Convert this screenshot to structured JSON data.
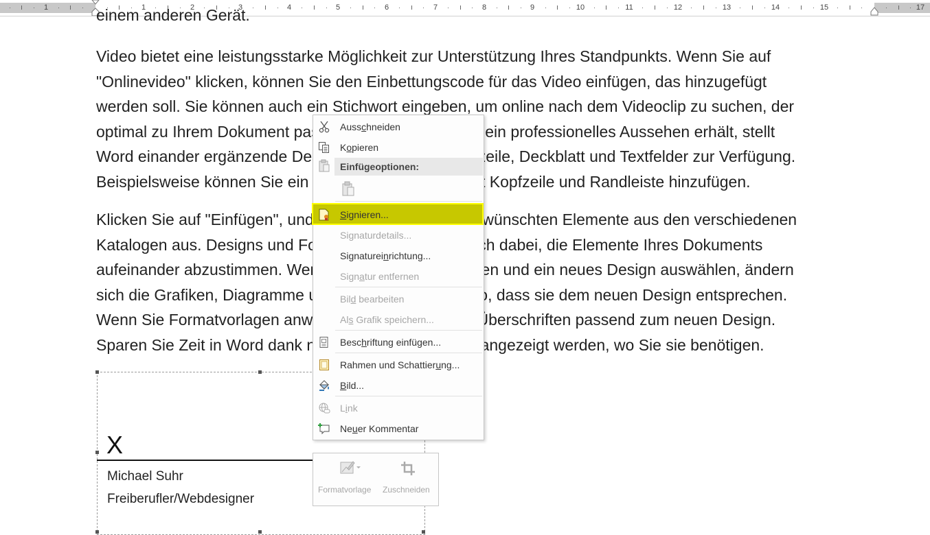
{
  "ruler": {
    "numbers_left": [
      "1"
    ],
    "numbers_right": [
      "1",
      "2",
      "3",
      "4",
      "5",
      "6",
      "7",
      "8",
      "9",
      "10",
      "11",
      "12",
      "13",
      "14",
      "15",
      "17"
    ]
  },
  "document": {
    "line_top": "einem anderen Gerät.",
    "para1": [
      "Video bietet eine leistungsstarke Möglichkeit zur Unterstützung Ihres Standpunkts. Wenn Sie auf",
      "\"Onlinevideo\" klicken, können Sie den Einbettungscode für das Video einfügen, das hinzugefügt",
      "werden soll. Sie können auch ein Stichwort eingeben, um online nach dem Videoclip zu suchen, der",
      "optimal zu Ihrem Dokument passt. Damit Ihr Dokument ein professionelles Aussehen erhält, stellt",
      "Word einander ergänzende Designs für Kopfzeile, Fußzeile, Deckblatt und Textfelder zur Verfügung.",
      "Beispielsweise können Sie ein passendes Deckblatt mit Kopfzeile und Randleiste hinzufügen."
    ],
    "para2": [
      "Klicken Sie auf \"Einfügen\", und wählen Sie dann die gewünschten Elemente aus den verschiedenen",
      "Katalogen aus. Designs und Formatvorlagen helfen auch dabei, die Elemente Ihres Dokuments",
      "aufeinander abzustimmen. Wenn Sie auf \"Design\" klicken und ein neues Design auswählen, ändern",
      "sich die Grafiken, Diagramme und SmartArt-Grafiken so, dass sie dem neuen Design entsprechen.",
      "Wenn Sie Formatvorlagen anwenden, ändern sich die Überschriften passend zum neuen Design.",
      "Sparen Sie Zeit in Word dank neuer Schaltflächen, die angezeigt werden, wo Sie sie benötigen."
    ]
  },
  "signature": {
    "x": "X",
    "name": "Michael Suhr",
    "title": "Freiberufler/Webdesigner"
  },
  "context_menu": {
    "cut": {
      "pre": "Auss",
      "u": "c",
      "post": "hneiden"
    },
    "copy": {
      "pre": "K",
      "u": "o",
      "post": "pieren"
    },
    "paste_header": "Einfügeoptionen:",
    "sign": {
      "pre": "",
      "u": "S",
      "post": "ignieren..."
    },
    "sig_details": {
      "pre": "Si",
      "u": "g",
      "post": "naturdetails..."
    },
    "sig_setup": {
      "pre": "Signaturei",
      "u": "n",
      "post": "richtung..."
    },
    "sig_remove": {
      "pre": "Sign",
      "u": "a",
      "post": "tur entfernen"
    },
    "edit_pic": {
      "pre": "Bil",
      "u": "d",
      "post": " bearbeiten"
    },
    "save_as_pic": {
      "pre": "Al",
      "u": "s",
      "post": " Grafik speichern..."
    },
    "caption": {
      "pre": "Besc",
      "u": "h",
      "post": "riftung einfügen..."
    },
    "borders": {
      "pre": "Rahmen und Schattier",
      "u": "u",
      "post": "ng..."
    },
    "picture": {
      "pre": "",
      "u": "B",
      "post": "ild..."
    },
    "link": {
      "pre": "L",
      "u": "i",
      "post": "nk"
    },
    "comment": {
      "pre": "Ne",
      "u": "u",
      "post": "er Kommentar"
    }
  },
  "mini_toolbar": {
    "style_label": "Formatvorlage",
    "crop_label": "Zuschneiden"
  },
  "colors": {
    "highlight_fill": "#c7c800",
    "highlight_border": "#ffff00",
    "disabled_text": "#a6a6a6"
  }
}
